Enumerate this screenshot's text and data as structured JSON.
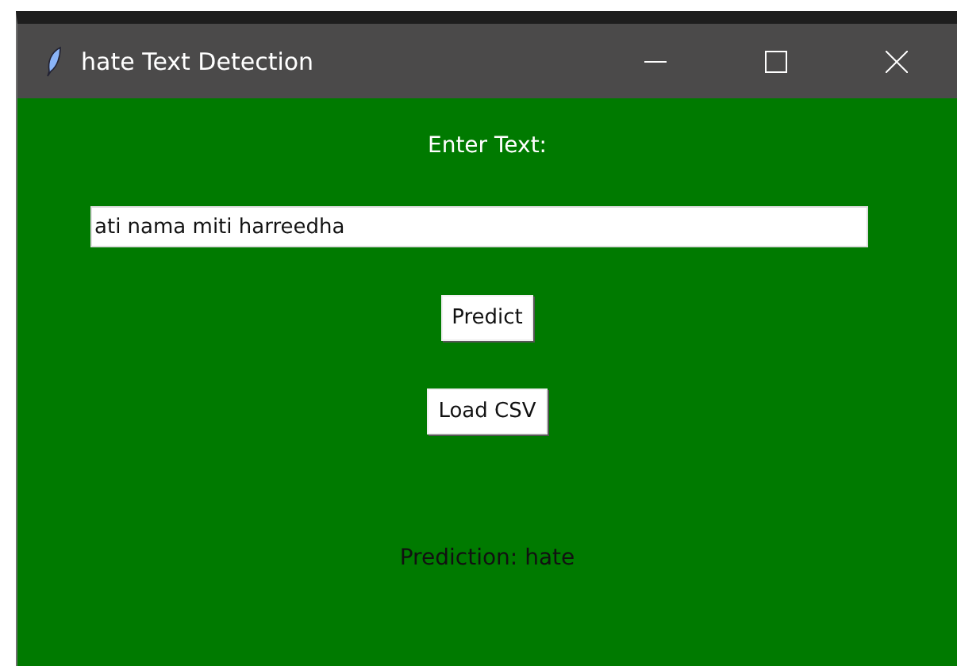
{
  "window": {
    "title": "hate Text Detection"
  },
  "prompt": "Enter Text:",
  "input": {
    "value": "ati nama miti harreedha"
  },
  "buttons": [
    "Predict",
    "Load CSV"
  ],
  "result": "Prediction: hate"
}
